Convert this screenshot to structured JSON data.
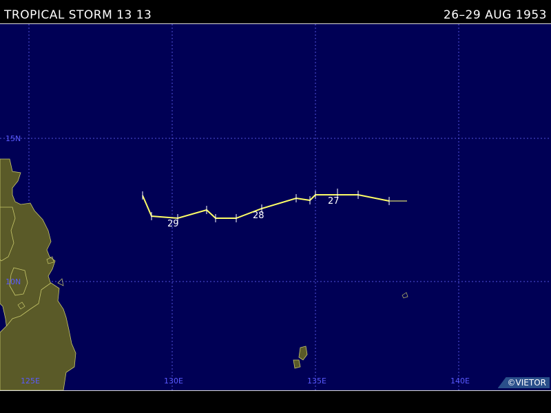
{
  "header": {
    "title": "TROPICAL STORM 13 13",
    "date_range": "26–29 AUG 1953"
  },
  "map": {
    "longitude_labels": [
      "125E",
      "130E",
      "135E",
      "140E"
    ],
    "latitude_labels": [
      "15N",
      "10N"
    ],
    "day_labels": [
      "29",
      "28",
      "27"
    ]
  },
  "credit": "©VIETOR",
  "colors": {
    "ocean": "#000055",
    "land": "#5a5a28",
    "track": "#ffff66",
    "grid": "#5555dd"
  }
}
